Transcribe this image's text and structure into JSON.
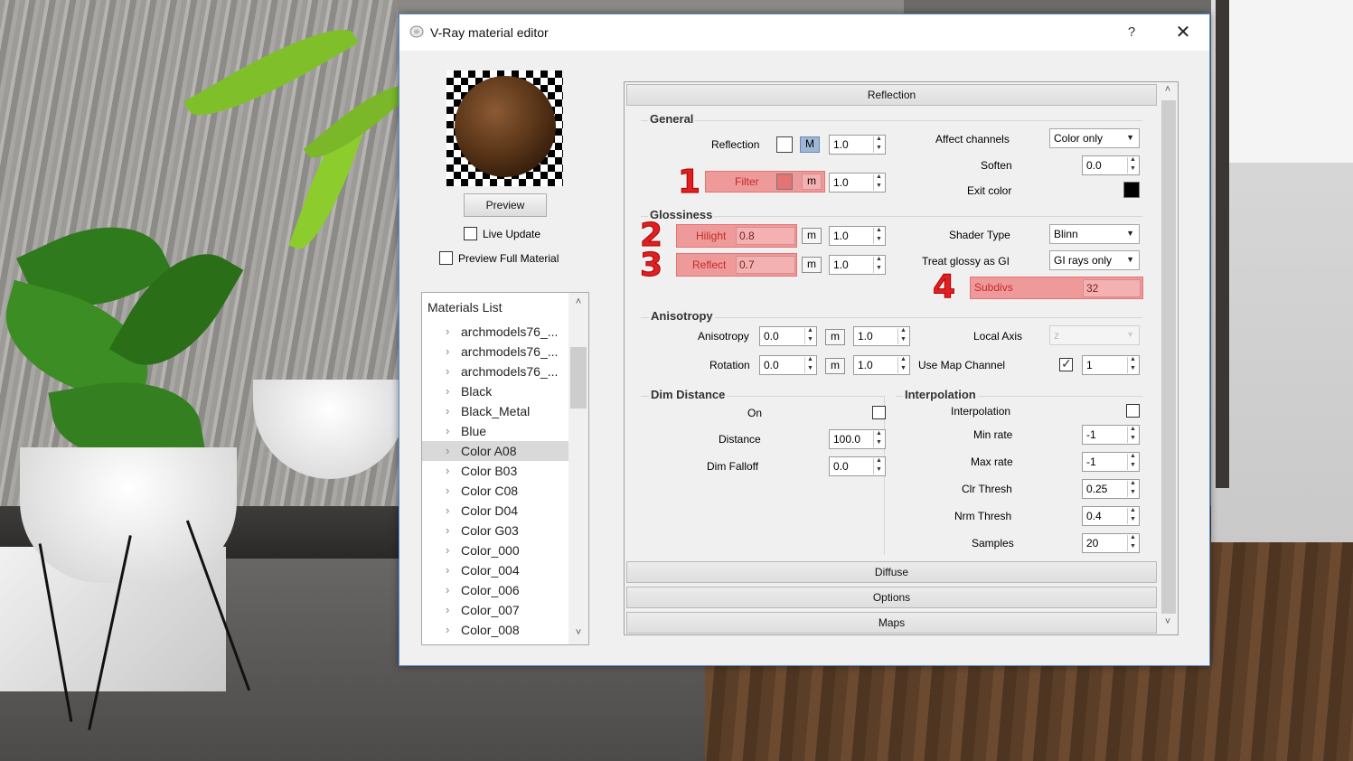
{
  "dialog": {
    "title": "V-Ray material editor",
    "help": "?",
    "close": "✕"
  },
  "preview": {
    "button": "Preview",
    "live_update": "Live Update",
    "preview_full": "Preview Full Material"
  },
  "materials": {
    "title": "Materials List",
    "items": [
      "archmodels76_...",
      "archmodels76_...",
      "archmodels76_...",
      "Black",
      "Black_Metal",
      "Blue",
      "Color A08",
      "Color B03",
      "Color C08",
      "Color D04",
      "Color G03",
      "Color_000",
      "Color_004",
      "Color_006",
      "Color_007",
      "Color_008"
    ],
    "selected": "Color A08"
  },
  "sections": {
    "reflection": "Reflection",
    "diffuse": "Diffuse",
    "options": "Options",
    "maps": "Maps"
  },
  "general": {
    "title": "General",
    "reflection_label": "Reflection",
    "reflection_m": "M",
    "reflection_value": "1.0",
    "filter_label": "Filter",
    "filter_m": "m",
    "filter_value": "1.0",
    "affect_channels_label": "Affect channels",
    "affect_channels_value": "Color only",
    "soften_label": "Soften",
    "soften_value": "0.0",
    "exit_color_label": "Exit color",
    "exit_color": "#000000"
  },
  "glossiness": {
    "title": "Glossiness",
    "hilight_label": "Hilight",
    "hilight_value": "0.8",
    "hilight_m": "m",
    "hilight_mult": "1.0",
    "reflect_label": "Reflect",
    "reflect_value": "0.7",
    "reflect_m": "m",
    "reflect_mult": "1.0",
    "shader_type_label": "Shader Type",
    "shader_type_value": "Blinn",
    "treat_glossy_label": "Treat glossy as GI",
    "treat_glossy_value": "GI rays only",
    "subdivs_label": "Subdivs",
    "subdivs_value": "32"
  },
  "anisotropy": {
    "title": "Anisotropy",
    "anisotropy_label": "Anisotropy",
    "anisotropy_value": "0.0",
    "anisotropy_m": "m",
    "anisotropy_mult": "1.0",
    "rotation_label": "Rotation",
    "rotation_value": "0.0",
    "rotation_m": "m",
    "rotation_mult": "1.0",
    "local_axis_label": "Local Axis",
    "local_axis_value": "z",
    "use_map_channel_label": "Use Map Channel",
    "map_channel_value": "1"
  },
  "dim_distance": {
    "title": "Dim Distance",
    "on_label": "On",
    "distance_label": "Distance",
    "distance_value": "100.0",
    "dim_falloff_label": "Dim Falloff",
    "dim_falloff_value": "0.0"
  },
  "interpolation": {
    "title": "Interpolation",
    "interp_label": "Interpolation",
    "min_rate_label": "Min rate",
    "min_rate_value": "-1",
    "max_rate_label": "Max rate",
    "max_rate_value": "-1",
    "clr_thresh_label": "Clr Thresh",
    "clr_thresh_value": "0.25",
    "nrm_thresh_label": "Nrm Thresh",
    "nrm_thresh_value": "0.4",
    "samples_label": "Samples",
    "samples_value": "20"
  },
  "callouts": [
    "1",
    "2",
    "3",
    "4"
  ],
  "colors": {
    "highlight": "#ef9a9a",
    "callout": "#e02020",
    "active_m": "#9fb7d6"
  }
}
